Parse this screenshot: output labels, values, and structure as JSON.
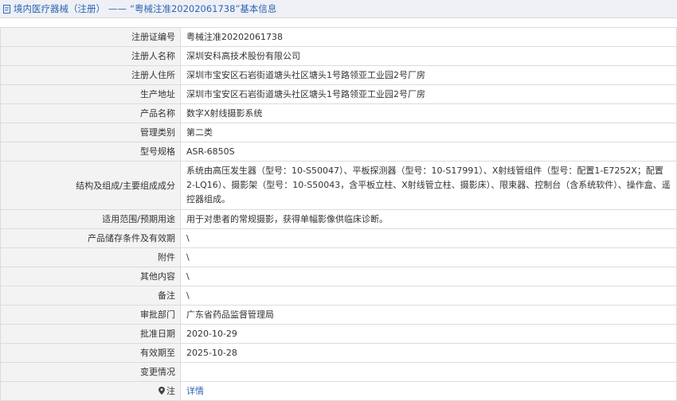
{
  "header": {
    "category": "境内医疗器械（注册）",
    "separator": "——",
    "subject": "“粤械注准20202061738”基本信息"
  },
  "rows": [
    {
      "label": "注册证编号",
      "value": "粤械注准20202061738"
    },
    {
      "label": "注册人名称",
      "value": "深圳安科高技术股份有限公司"
    },
    {
      "label": "注册人住所",
      "value": "深圳市宝安区石岩街道塘头社区塘头1号路领亚工业园2号厂房"
    },
    {
      "label": "生产地址",
      "value": "深圳市宝安区石岩街道塘头社区塘头1号路领亚工业园2号厂房"
    },
    {
      "label": "产品名称",
      "value": "数字X射线摄影系统"
    },
    {
      "label": "管理类别",
      "value": "第二类"
    },
    {
      "label": "型号规格",
      "value": "ASR-6850S"
    },
    {
      "label": "结构及组成/主要组成成分",
      "value": "系统由高压发生器（型号：10-S50047）、平板探测器（型号：10-S17991）、X射线管组件（型号：配置1-E7252X；配置2-LQ16）、摄影架（型号：10-S50043，含平板立柱、X射线管立柱、摄影床）、限束器、控制台（含系统软件）、操作盒、遥控器组成。"
    },
    {
      "label": "适用范围/预期用途",
      "value": "用于对患者的常规摄影，获得单幅影像供临床诊断。"
    },
    {
      "label": "产品储存条件及有效期",
      "value": "\\"
    },
    {
      "label": "附件",
      "value": "\\"
    },
    {
      "label": "其他内容",
      "value": "\\"
    },
    {
      "label": "备注",
      "value": "\\"
    },
    {
      "label": "审批部门",
      "value": "广东省药品监督管理局"
    },
    {
      "label": "批准日期",
      "value": "2020-10-29"
    },
    {
      "label": "有效期至",
      "value": "2025-10-28"
    },
    {
      "label": "变更情况",
      "value": ""
    }
  ],
  "footer_row": {
    "label": "注",
    "link_text": "详情"
  },
  "colors": {
    "accent": "#2c64b4",
    "label_bg": "#f3f3f3",
    "border": "#dcdcdc"
  }
}
